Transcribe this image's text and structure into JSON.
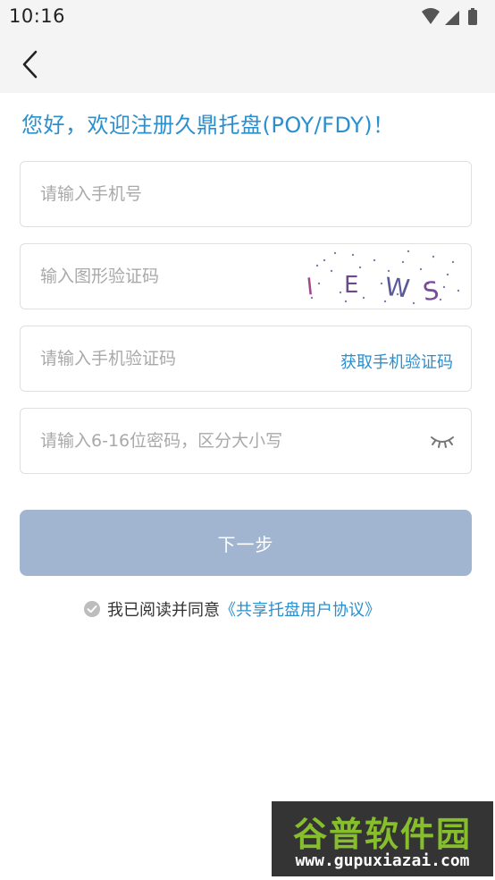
{
  "status_bar": {
    "time": "10:16",
    "icons": [
      "wifi-icon",
      "signal-icon",
      "battery-icon"
    ]
  },
  "header": {
    "back_icon": "chevron-left-icon"
  },
  "welcome": "您好，欢迎注册久鼎托盘(POY/FDY)！",
  "form": {
    "phone_placeholder": "请输入手机号",
    "captcha_placeholder": "输入图形验证码",
    "captcha_letters": [
      "I",
      "E",
      "W",
      "S"
    ],
    "sms_placeholder": "请输入手机验证码",
    "get_code_label": "获取手机验证码",
    "password_placeholder": "请输入6-16位密码，区分大小写",
    "eye_icon": "eye-closed-icon"
  },
  "next_button": "下一步",
  "agreement": {
    "text": "我已阅读并同意",
    "link": "《共享托盘用户协议》"
  },
  "watermark": {
    "title": "谷普软件园",
    "url": "www.gupuxiazai.com"
  },
  "colors": {
    "accent": "#2a8fcf",
    "button_disabled": "#a1b5d0",
    "placeholder": "#a9a9a9",
    "border": "#e0e0e0",
    "topbar": "#f4f4f4"
  }
}
